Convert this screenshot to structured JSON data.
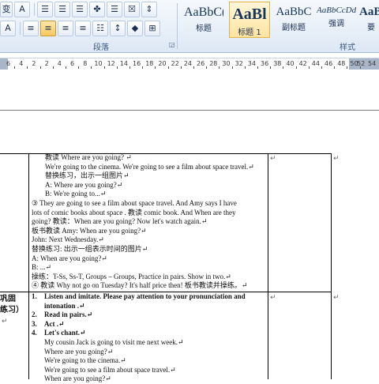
{
  "toolbar": {
    "row1": [
      "⊞",
      "A",
      "☰",
      "☰",
      "☰",
      "✤",
      "☰",
      "☒",
      "⇕"
    ],
    "row2": [
      "A",
      "≡",
      "≡",
      "≡",
      "≡",
      "☷",
      "↕",
      "◆",
      "⊞"
    ],
    "row1_first": "变",
    "paragraph_group_label": "段落",
    "styles_group_label": "样式",
    "launcher": "◲"
  },
  "styles": [
    {
      "sample": "AaBbC(",
      "name": "标题"
    },
    {
      "sample": "AaBl",
      "name": "标题 1"
    },
    {
      "sample": "AaBbC",
      "name": "副标题"
    },
    {
      "sample": "AaBbCcDd",
      "name": "强调"
    },
    {
      "sample": "AaBb",
      "name": "要"
    }
  ],
  "ruler": {
    "numbers": [
      "6",
      "4",
      "2",
      "2",
      "4",
      "6",
      "8",
      "10",
      "12",
      "14",
      "16",
      "18",
      "20",
      "22",
      "24",
      "26",
      "28",
      "30",
      "32",
      "34",
      "36",
      "38",
      "40",
      "42",
      "44",
      "46",
      "48",
      "50"
    ],
    "end_numbers": [
      "52",
      "54"
    ]
  },
  "document": {
    "upper_cell_lines": [
      "教读 Where are you going? ↵",
      "We're going to the cinema. We're going to see a film about space travel.↵",
      "替换练习，出示一组图片↵",
      "A: Where are you going?↵",
      "B: We're going to...↵",
      "③  They are going to see a film about space travel. And Amy says I have",
      "lots of comic books about space . 教读 comic book. And When are they",
      "going? 教读：When are you going? Now let's watch again.↵",
      "板书教读 Amy: When are you going?↵",
      "                    John: Next Wednesday.↵",
      "替换练习: 出示一组表示时间的图片↵",
      "A: When are you going?↵",
      "B: ...↵",
      "操练：T-Ss, Ss-T, Groups – Groups, Practice in pairs. Show in two.↵",
      "④ 教读 Why not go on Tuesday? It's half price then! 板书教读并操练。↵"
    ],
    "section_label_line1": "巩固",
    "section_label_line2": "练习）",
    "left_tail": "↵",
    "lower_items": [
      {
        "num": "1.",
        "text": "Listen and imitate. Please pay attention to your pronunciation and",
        "bold": true
      },
      {
        "num": "",
        "text": "intonation .↵",
        "bold": true
      },
      {
        "num": "2.",
        "text": "Read in pairs.↵",
        "bold": true
      },
      {
        "num": "3.",
        "text": "Act .↵",
        "bold": true
      },
      {
        "num": "4.",
        "text": "Let's chant.↵",
        "bold": true
      },
      {
        "num": "",
        "text": "My cousin Jack is going to visit me next week.↵",
        "bold": false
      },
      {
        "num": "",
        "text": "Where are you going?↵",
        "bold": false
      },
      {
        "num": "",
        "text": "We're going to the cinema.↵",
        "bold": false
      },
      {
        "num": "",
        "text": "We're going to see a film about space travel.↵",
        "bold": false
      },
      {
        "num": "",
        "text": "When are you going?↵",
        "bold": false
      }
    ],
    "cell_end_mark": "↵",
    "row_end_mark": "↵"
  }
}
